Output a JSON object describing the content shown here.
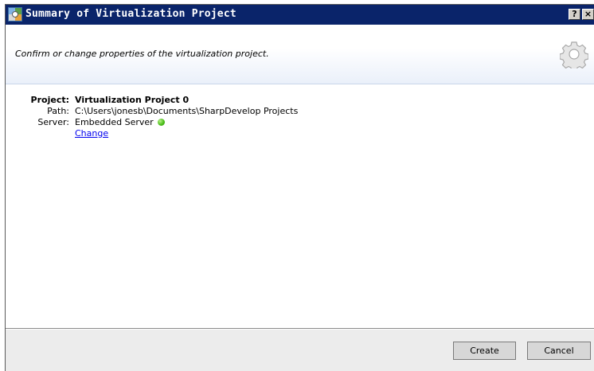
{
  "window": {
    "title": "Summary of Virtualization Project",
    "help_label": "?",
    "close_label": "×"
  },
  "header": {
    "subtitle": "Confirm or change properties of the virtualization project."
  },
  "properties": {
    "project_label": "Project:",
    "project_value": "Virtualization Project 0",
    "path_label": "Path:",
    "path_value": "C:\\Users\\jonesb\\Documents\\SharpDevelop Projects",
    "server_label": "Server:",
    "server_value": "Embedded Server",
    "server_status": "running",
    "change_link": "Change"
  },
  "footer": {
    "create_label": "Create",
    "cancel_label": "Cancel"
  },
  "colors": {
    "titlebar": "#0a246a",
    "status_ok": "#4cbf1a",
    "link": "#0000ee"
  }
}
